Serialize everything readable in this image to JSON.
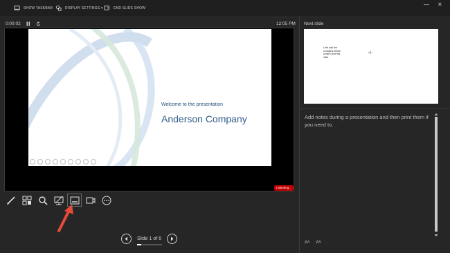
{
  "topbar": {
    "show_taskbar": "SHOW TASKBAR",
    "display_settings": "DISPLAY SETTINGS ▾",
    "end_slide_show": "END SLIDE SHOW",
    "minimize": "—",
    "close": "✕"
  },
  "presenter": {
    "timer": "0:00:02",
    "clock": "12:05 PM",
    "listening": "Listening..."
  },
  "current_slide": {
    "subtitle": "Welcome to the presentation",
    "title": "Anderson Company"
  },
  "navigation": {
    "slide_count": "Slide 1 of 6"
  },
  "next_slide": {
    "label": "Next slide",
    "text": "Let's add the company theme song to just this slide."
  },
  "notes": {
    "placeholder": "Add notes during a presentation and then print them if you need to."
  },
  "font_buttons": {
    "increase": "A˄",
    "decrease": "A˅"
  },
  "colors": {
    "background": "#262626",
    "accent_red": "#c00000",
    "annotation_arrow": "#e8493c"
  }
}
